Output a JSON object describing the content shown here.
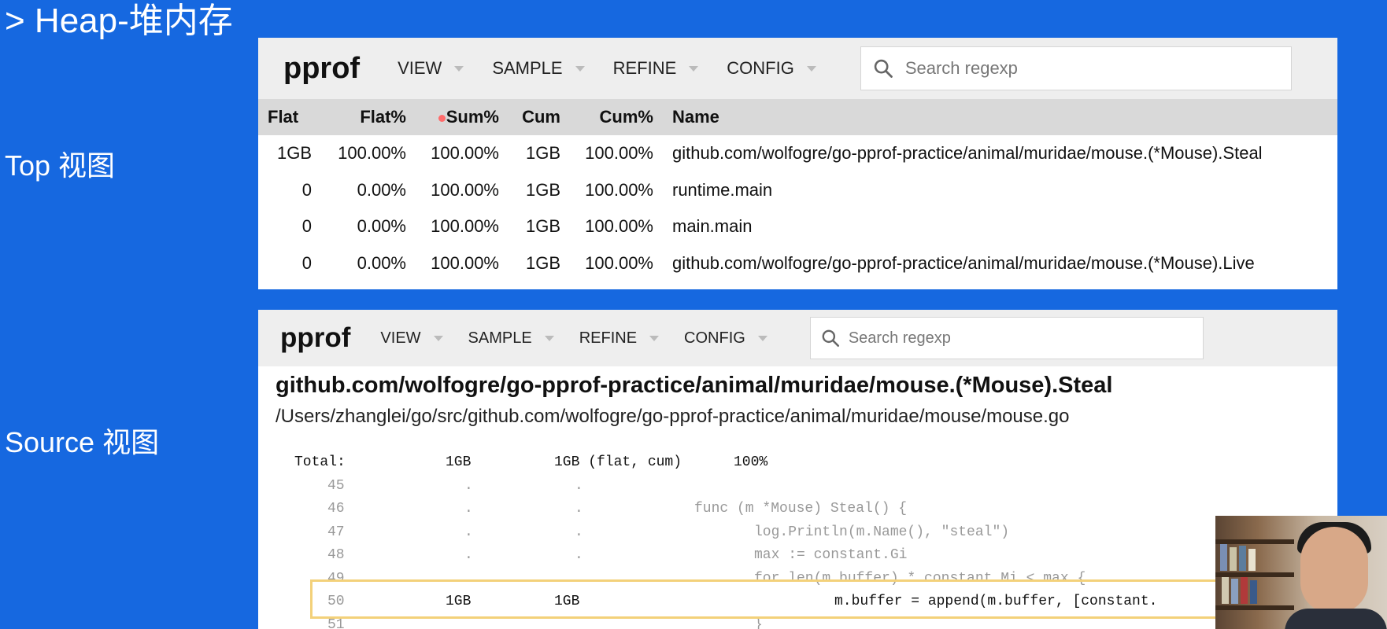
{
  "slide": {
    "title": "> Heap-堆内存",
    "top_label": "Top 视图",
    "source_label": "Source 视图"
  },
  "colors": {
    "background": "#1668e0",
    "toolbar": "#eeeeee",
    "header": "#d9d9d9",
    "highlight_border": "#f3d17a"
  },
  "top_panel": {
    "logo": "pprof",
    "menu": [
      "VIEW",
      "SAMPLE",
      "REFINE",
      "CONFIG"
    ],
    "search_placeholder": "Search regexp",
    "columns": [
      "Flat",
      "Flat%",
      "Sum%",
      "Cum",
      "Cum%",
      "Name"
    ],
    "rows": [
      {
        "flat": "1GB",
        "flat_pct": "100.00%",
        "sum_pct": "100.00%",
        "cum": "1GB",
        "cum_pct": "100.00%",
        "name": "github.com/wolfogre/go-pprof-practice/animal/muridae/mouse.(*Mouse).Steal"
      },
      {
        "flat": "0",
        "flat_pct": "0.00%",
        "sum_pct": "100.00%",
        "cum": "1GB",
        "cum_pct": "100.00%",
        "name": "runtime.main"
      },
      {
        "flat": "0",
        "flat_pct": "0.00%",
        "sum_pct": "100.00%",
        "cum": "1GB",
        "cum_pct": "100.00%",
        "name": "main.main"
      },
      {
        "flat": "0",
        "flat_pct": "0.00%",
        "sum_pct": "100.00%",
        "cum": "1GB",
        "cum_pct": "100.00%",
        "name": "github.com/wolfogre/go-pprof-practice/animal/muridae/mouse.(*Mouse).Live"
      }
    ]
  },
  "source_panel": {
    "logo": "pprof",
    "menu": [
      "VIEW",
      "SAMPLE",
      "REFINE",
      "CONFIG"
    ],
    "search_placeholder": "Search regexp",
    "function_name": "github.com/wolfogre/go-pprof-practice/animal/muridae/mouse.(*Mouse).Steal",
    "file_path": "/Users/zhanglei/go/src/github.com/wolfogre/go-pprof-practice/animal/muridae/mouse/mouse.go",
    "total": {
      "label": "Total:",
      "flat": "1GB",
      "cum": "1GB (flat, cum)",
      "pct": "100%"
    },
    "lines": [
      {
        "num": "45",
        "flat": ".",
        "cum": ".",
        "code": ""
      },
      {
        "num": "46",
        "flat": ".",
        "cum": ".",
        "code": "func (m *Mouse) Steal() {"
      },
      {
        "num": "47",
        "flat": ".",
        "cum": ".",
        "code": "log.Println(m.Name(), \"steal\")"
      },
      {
        "num": "48",
        "flat": ".",
        "cum": ".",
        "code": "max := constant.Gi"
      },
      {
        "num": "49",
        "flat": ".",
        "cum": ".",
        "code": "for len(m.buffer) * constant.Mi < max {"
      },
      {
        "num": "50",
        "flat": "1GB",
        "cum": "1GB",
        "code": "m.buffer = append(m.buffer, [constant."
      },
      {
        "num": "51",
        "flat": "",
        "cum": "",
        "code": "}"
      }
    ]
  }
}
